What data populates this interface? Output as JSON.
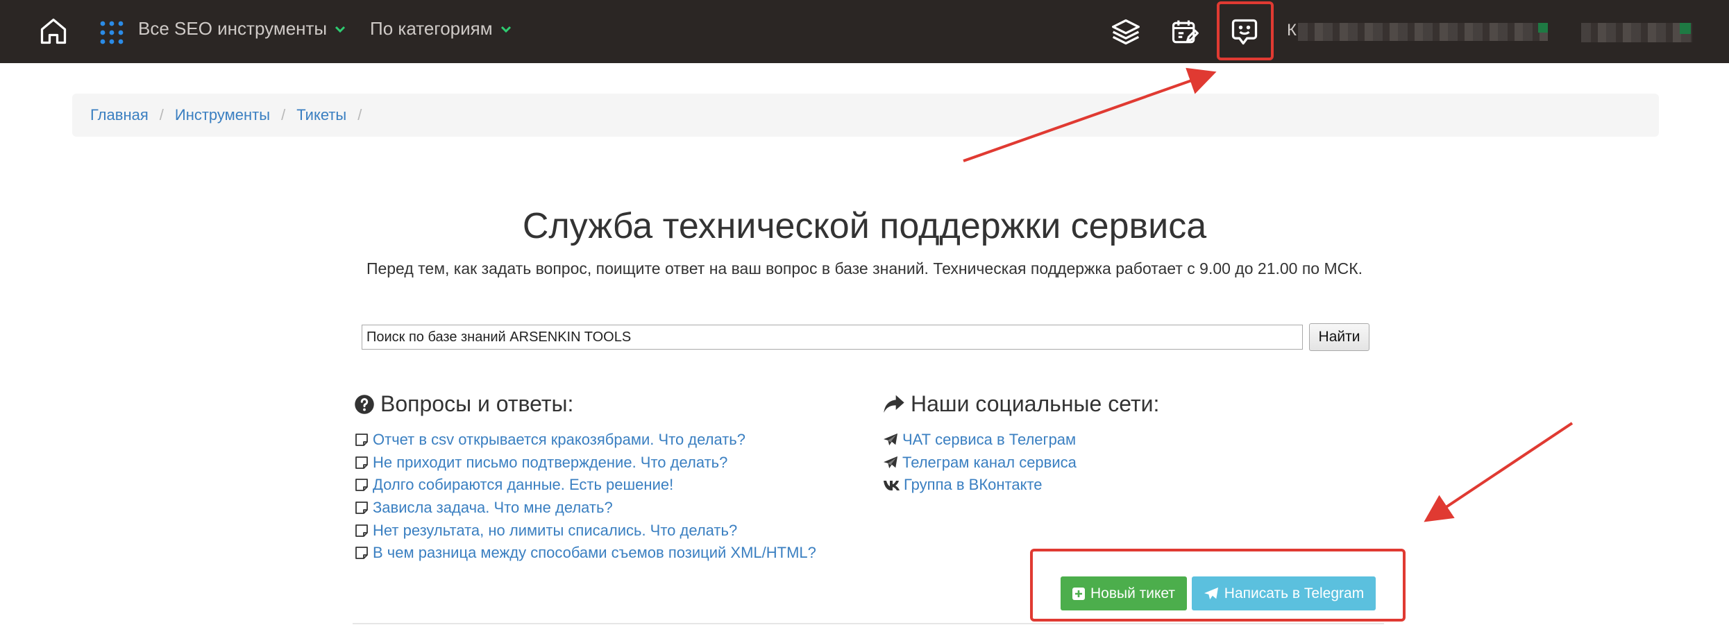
{
  "navbar": {
    "all_tools_label": "Все SEO инструменты",
    "categories_label": "По категориям",
    "account_name_partial": "К",
    "icons": [
      "home-icon",
      "apps-grid-icon",
      "layers-icon",
      "calendar-edit-icon",
      "support-chat-icon"
    ]
  },
  "breadcrumb": {
    "items": [
      "Главная",
      "Инструменты",
      "Тикеты"
    ],
    "separator": "/"
  },
  "page": {
    "title": "Служба технической поддержки сервиса",
    "subtitle": "Перед тем, как задать вопрос, поищите ответ на ваш вопрос в базе знаний. Техническая поддержка работает с 9.00 до 21.00 по МСК."
  },
  "search": {
    "value": "Поиск по базе знаний ARSENKIN TOOLS",
    "button_label": "Найти"
  },
  "faq": {
    "heading": "Вопросы и ответы:",
    "items": [
      "Отчет в csv открывается кракозябрами. Что делать?",
      "Не приходит письмо подтверждение. Что делать?",
      "Долго собираются данные. Есть решение!",
      "Зависла задача. Что мне делать?",
      "Нет результата, но лимиты списались. Что делать?",
      "В чем разница между способами съемов позиций XML/HTML?"
    ]
  },
  "social": {
    "heading": "Наши социальные сети:",
    "items": [
      {
        "label": "ЧАТ сервиса в Телеграм",
        "icon": "telegram-icon"
      },
      {
        "label": "Телеграм канал сервиса",
        "icon": "telegram-icon"
      },
      {
        "label": "Группа в ВКонтакте",
        "icon": "vk-icon"
      }
    ]
  },
  "actions": {
    "new_ticket_label": "Новый тикет",
    "telegram_label": "Написать в Telegram"
  },
  "colors": {
    "navbar_bg": "#2b2624",
    "link": "#3a7fc1",
    "accent_green": "#4cae4c",
    "accent_blue": "#5bc0de",
    "annotation_red": "#e03a32",
    "nav_chevron": "#2ecc71",
    "grid_icon": "#2b8be6"
  }
}
